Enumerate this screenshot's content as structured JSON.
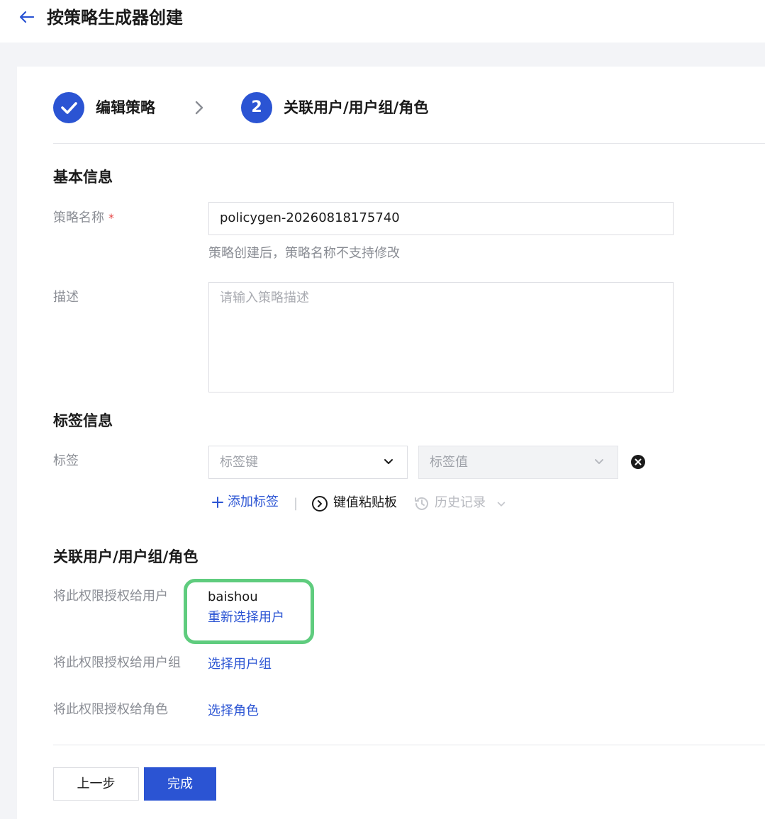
{
  "header": {
    "title": "按策略生成器创建"
  },
  "steps": [
    {
      "label": "编辑策略"
    },
    {
      "number": "2",
      "label": "关联用户/用户组/角色"
    }
  ],
  "basic_info": {
    "title": "基本信息",
    "name_label": "策略名称",
    "required_mark": "*",
    "name_value": "policygen-20260818175740",
    "name_hint": "策略创建后，策略名称不支持修改",
    "desc_label": "描述",
    "desc_placeholder": "请输入策略描述"
  },
  "tag_info": {
    "title": "标签信息",
    "tag_label": "标签",
    "key_placeholder": "标签键",
    "value_placeholder": "标签值",
    "add_tag": "添加标签",
    "separator": "|",
    "paste_board": "键值粘贴板",
    "history": "历史记录"
  },
  "association": {
    "title": "关联用户/用户组/角色",
    "users_label": "将此权限授权给用户",
    "selected_user": "baishou",
    "reselect_user": "重新选择用户",
    "groups_label": "将此权限授权给用户组",
    "select_group": "选择用户组",
    "roles_label": "将此权限授权给角色",
    "select_role": "选择角色"
  },
  "footer": {
    "prev": "上一步",
    "finish": "完成"
  },
  "colors": {
    "primary": "#2b54d3",
    "highlight": "#5fcc7e",
    "required": "#e54545"
  }
}
